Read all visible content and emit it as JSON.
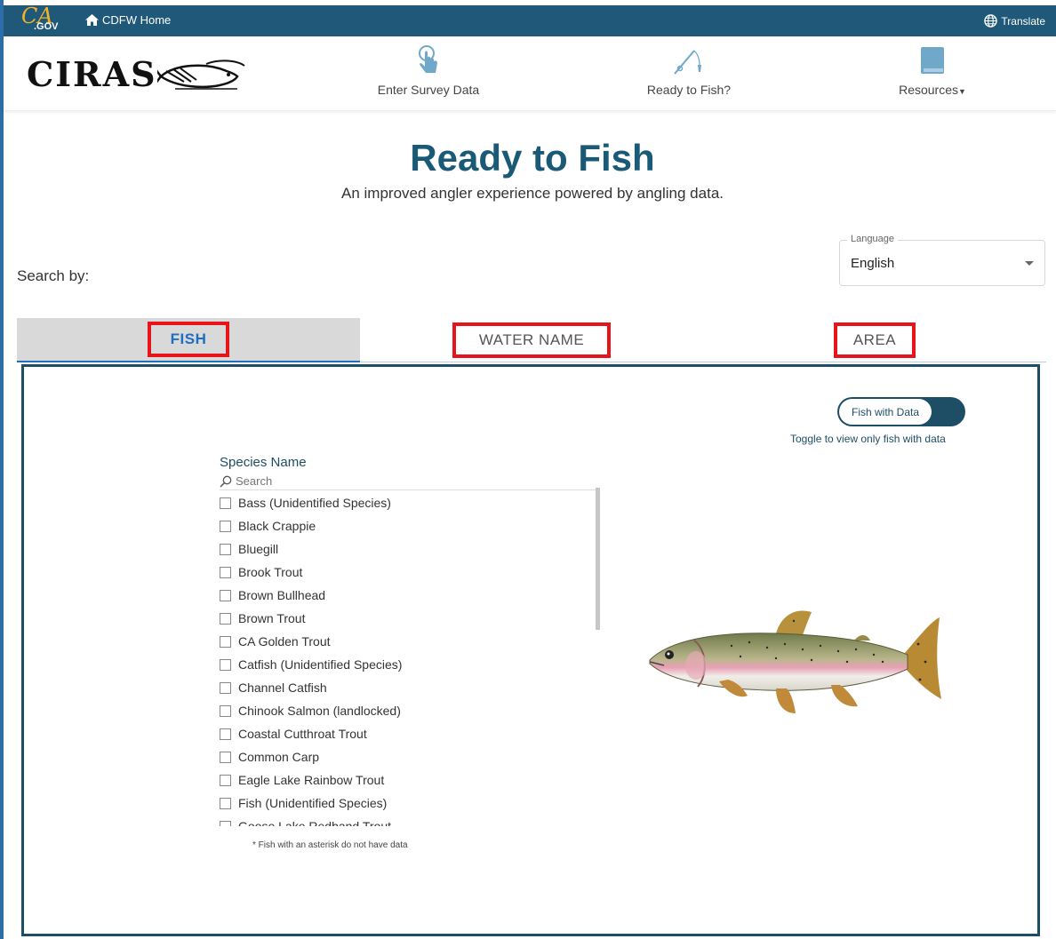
{
  "topbar": {
    "ca_logo_text": "CA",
    "ca_logo_suffix": ".GOV",
    "home_label": "CDFW Home",
    "translate_label": "Translate"
  },
  "header": {
    "logo_text": "CIRAS",
    "nav": [
      {
        "label": "Enter Survey Data",
        "icon": "pointer-hand-icon"
      },
      {
        "label": "Ready to Fish?",
        "icon": "fishing-rod-icon"
      },
      {
        "label": "Resources",
        "icon": "book-icon"
      }
    ]
  },
  "hero": {
    "title": "Ready to Fish",
    "subtitle": "An improved angler experience powered by angling data."
  },
  "search_by_label": "Search by:",
  "language": {
    "label": "Language",
    "value": "English"
  },
  "tabs": [
    {
      "label": "FISH",
      "active": true
    },
    {
      "label": "WATER NAME",
      "active": false
    },
    {
      "label": "AREA",
      "active": false
    }
  ],
  "panel": {
    "toggle_label": "Fish with Data",
    "toggle_hint": "Toggle to view only fish with data",
    "species_title": "Species Name",
    "search_placeholder": "Search",
    "species": [
      "Bass (Unidentified Species)",
      "Black Crappie",
      "Bluegill",
      "Brook Trout",
      "Brown Bullhead",
      "Brown Trout",
      "CA Golden Trout",
      "Catfish (Unidentified Species)",
      "Channel Catfish",
      "Chinook Salmon (landlocked)",
      "Coastal Cutthroat Trout",
      "Common Carp",
      "Eagle Lake Rainbow Trout",
      "Fish (Unidentified Species)",
      "Goose Lake Redband Trout"
    ],
    "footnote": "* Fish with an asterisk do not have data"
  },
  "colors": {
    "brand_dark": "#1f5878",
    "title_blue": "#1b5a76",
    "panel_border": "#1e4d66",
    "active_tab_text": "#1f6fbf",
    "highlight_red": "#e8141c"
  }
}
